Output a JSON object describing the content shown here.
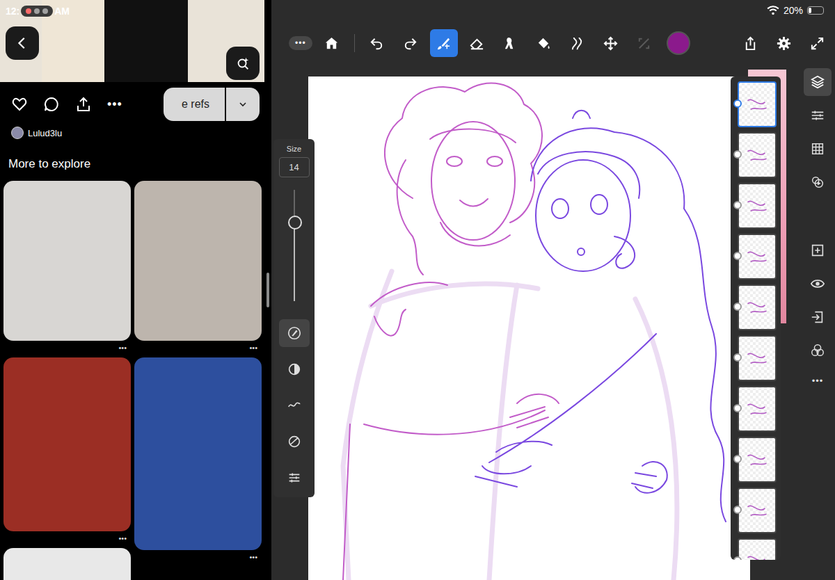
{
  "status_bar": {
    "time_parts": [
      "12:",
      "AM"
    ],
    "battery": "20%",
    "battery_level": 0.2,
    "wifi": true
  },
  "pinterest": {
    "board_button": "e refs",
    "more": "•••",
    "author": "Lulud3lu",
    "section_title": "More to explore",
    "pins": [
      {
        "more": "•••",
        "color": "#d8d6d3"
      },
      {
        "more": "•••",
        "color": "#bdb5ad"
      },
      {
        "more": "•••",
        "color": "#9b2e24"
      },
      {
        "more": "•••",
        "color": "#2d4f9e"
      }
    ]
  },
  "toolbar": {
    "menu": "•••",
    "color": "#8b1a8c",
    "tools": [
      {
        "kind": "undo",
        "selected": false,
        "disabled": false
      },
      {
        "kind": "redo",
        "selected": false,
        "disabled": false
      },
      {
        "kind": "brush",
        "selected": true,
        "disabled": false
      },
      {
        "kind": "eraser",
        "selected": false,
        "disabled": false
      },
      {
        "kind": "smudge",
        "selected": false,
        "disabled": false
      },
      {
        "kind": "fill",
        "selected": false,
        "disabled": false
      },
      {
        "kind": "liquify",
        "selected": false,
        "disabled": false
      },
      {
        "kind": "transform",
        "selected": false,
        "disabled": false
      },
      {
        "kind": "select",
        "selected": false,
        "disabled": true
      }
    ]
  },
  "brush_panel": {
    "label": "Size",
    "value": "14",
    "level": 0.7,
    "tools": [
      {
        "kind": "brush-settings",
        "selected": true
      },
      {
        "kind": "contrast",
        "selected": false
      },
      {
        "kind": "stabilizer",
        "selected": false
      },
      {
        "kind": "pressure",
        "selected": false
      },
      {
        "kind": "sliders",
        "selected": false
      }
    ]
  },
  "layers": [
    {
      "selected": true
    },
    {
      "selected": false
    },
    {
      "selected": false
    },
    {
      "selected": false
    },
    {
      "selected": false
    },
    {
      "selected": false
    },
    {
      "selected": false
    },
    {
      "selected": false
    },
    {
      "selected": false
    },
    {
      "selected": false
    }
  ],
  "sidebar": {
    "more": "•••",
    "items": [
      {
        "kind": "layers",
        "selected": true
      },
      {
        "kind": "adjust",
        "selected": false
      },
      {
        "kind": "grid",
        "selected": false
      },
      {
        "kind": "motion",
        "selected": false
      },
      {
        "kind": "add",
        "selected": false
      },
      {
        "kind": "eye",
        "selected": false
      },
      {
        "kind": "import",
        "selected": false
      },
      {
        "kind": "blend",
        "selected": false
      }
    ]
  }
}
